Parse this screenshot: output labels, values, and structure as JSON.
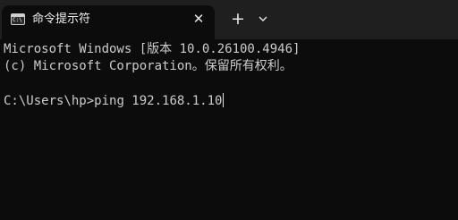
{
  "tab": {
    "icon": "command-prompt-icon",
    "icon_glyph": "C:\\",
    "title": "命令提示符",
    "close_glyph": "✕"
  },
  "toolbar": {
    "new_tab_glyph": "+",
    "dropdown_icon": "chevron-down-icon"
  },
  "console": {
    "lines": [
      "Microsoft Windows [版本 10.0.26100.4946]",
      "(c) Microsoft Corporation。保留所有权利。"
    ],
    "prompt": "C:\\Users\\hp>",
    "command": "ping 192.168.1.10"
  },
  "colors": {
    "background": "#0c0c0c",
    "titlebar": "#1f1f1f",
    "text": "#cccccc"
  }
}
